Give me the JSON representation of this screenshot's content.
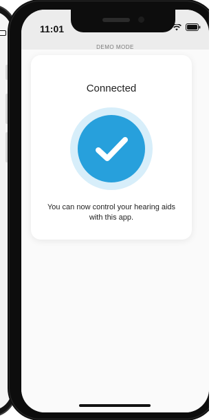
{
  "status_bar": {
    "time": "11:01",
    "icons": [
      "signal-icon",
      "wifi-icon",
      "battery-icon"
    ]
  },
  "banner": {
    "demo_mode": "DEMO MODE"
  },
  "card": {
    "title": "Connected",
    "icon": "checkmark-icon",
    "message": "You can now control your hearing aids with this app."
  },
  "colors": {
    "accent": "#27a0dc",
    "accent_halo": "#d7eefa",
    "status_bg": "#ececec"
  }
}
